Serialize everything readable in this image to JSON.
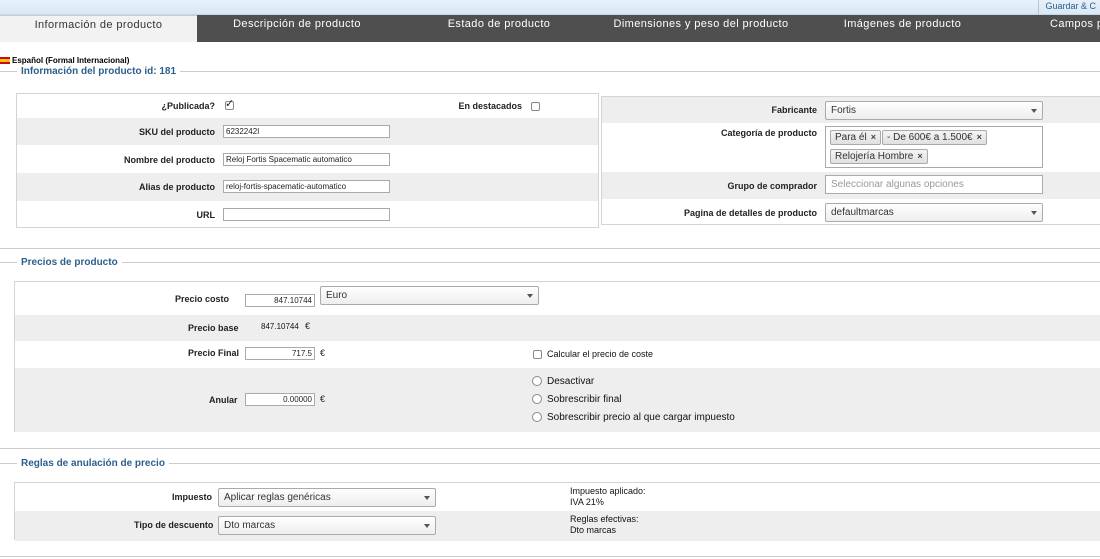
{
  "header": {
    "save_link": "Guardar & C"
  },
  "tabs": [
    {
      "label": "Información de producto",
      "active": true
    },
    {
      "label": "Descripción de producto"
    },
    {
      "label": "Estado de producto"
    },
    {
      "label": "Dimensiones y peso del producto"
    },
    {
      "label": "Imágenes de producto"
    },
    {
      "label": "Campos pe"
    }
  ],
  "language": {
    "label": "Español (Formal Internacional)"
  },
  "info": {
    "legend": "Información del producto id: 181",
    "published_label": "¿Publicada?",
    "published_checked": true,
    "featured_label": "En destacados",
    "featured_checked": false,
    "sku_label": "SKU del producto",
    "sku_value": "6232242I",
    "name_label": "Nombre del producto",
    "name_value": "Reloj Fortis Spacematic automatico",
    "alias_label": "Alias de producto",
    "alias_value": "reloj-fortis-spacematic-automatico",
    "url_label": "URL",
    "url_value": "",
    "manufacturer_label": "Fabricante",
    "manufacturer_value": "Fortis",
    "category_label": "Categoría de producto",
    "categories": [
      "Para él",
      "- De 600€ a 1.500€",
      "Relojería Hombre"
    ],
    "buyer_group_label": "Grupo de comprador",
    "buyer_group_placeholder": "Seleccionar algunas opciones",
    "details_page_label": "Pagina de detalles de producto",
    "details_page_value": "defaultmarcas"
  },
  "prices": {
    "legend": "Precios de producto",
    "cost_label": "Precio costo",
    "cost_value": "847.10744",
    "currency_value": "Euro",
    "base_label": "Precio base",
    "base_value": "847.10744",
    "currency_symbol": "€",
    "final_label": "Precio Final",
    "final_value": "717.5",
    "calc_cost_label": "Calcular el precio de coste",
    "override_label": "Anular",
    "override_value": "0.00000",
    "radio_options": [
      "Desactivar",
      "Sobrescribir final",
      "Sobrescribir precio al que cargar impuesto"
    ]
  },
  "rules": {
    "legend": "Reglas de anulación de precio",
    "tax_label": "Impuesto",
    "tax_value": "Aplicar reglas genéricas",
    "discount_label": "Tipo de descuento",
    "discount_value": "Dto marcas",
    "applied_tax_title": "Impuesto aplicado:",
    "applied_tax_value": "IVA 21%",
    "effective_rules_title": "Reglas efectivas:",
    "effective_rules_value": "Dto marcas"
  }
}
